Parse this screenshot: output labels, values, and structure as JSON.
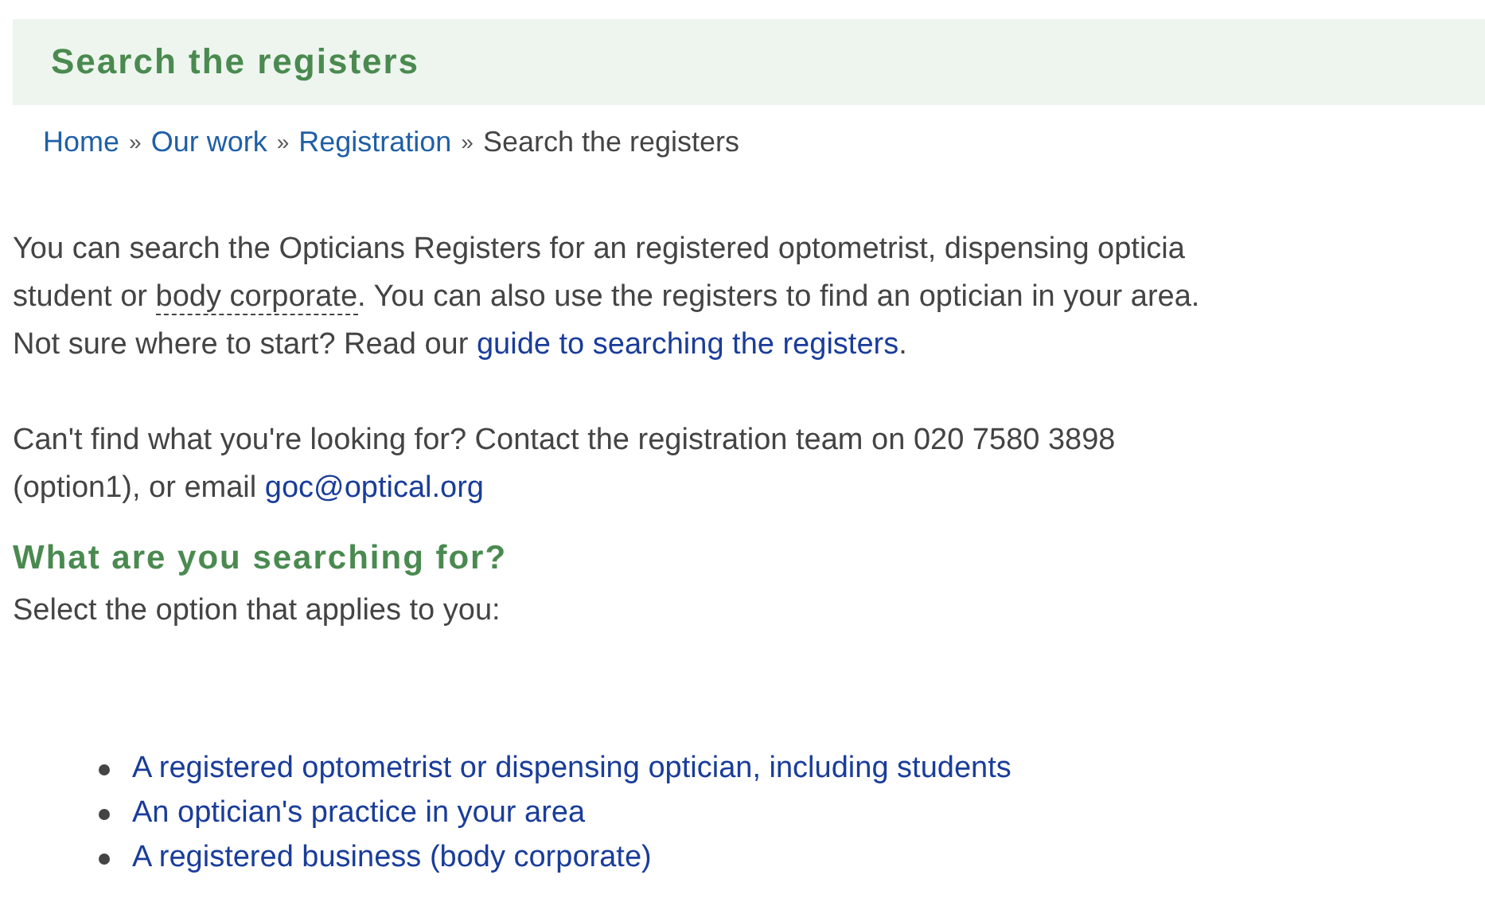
{
  "title": "Search the registers",
  "breadcrumb": [
    {
      "label": "Home",
      "kind": "link"
    },
    {
      "label": "Our work",
      "kind": "link"
    },
    {
      "label": "Registration",
      "kind": "link"
    },
    {
      "label": "Search the registers",
      "kind": "current"
    }
  ],
  "breadcrumb_separator": "»",
  "intro": [
    {
      "kind": "text",
      "text": "You can search the Opticians Registers for an registered optometrist, dispensing opticia\nstudent or "
    },
    {
      "kind": "abbr",
      "text": "body corporate"
    },
    {
      "kind": "text",
      "text": ". You can also use the registers to find an optician in your area.\nNot sure where to start? Read our "
    },
    {
      "kind": "link",
      "text": "guide to searching the registers"
    },
    {
      "kind": "text",
      "text": "."
    }
  ],
  "contact": [
    {
      "kind": "text",
      "text": "Can't find what you're looking for? Contact the registration team on 020 7580 3898\n(option1), or email "
    },
    {
      "kind": "link",
      "text": "goc@optical.org"
    }
  ],
  "heading": "What are you searching for?",
  "instruction": "Select the option that applies to you:",
  "options": [
    "A registered optometrist or dispensing optician, including students",
    "An optician's practice in your area",
    "A registered business (body corporate)"
  ]
}
